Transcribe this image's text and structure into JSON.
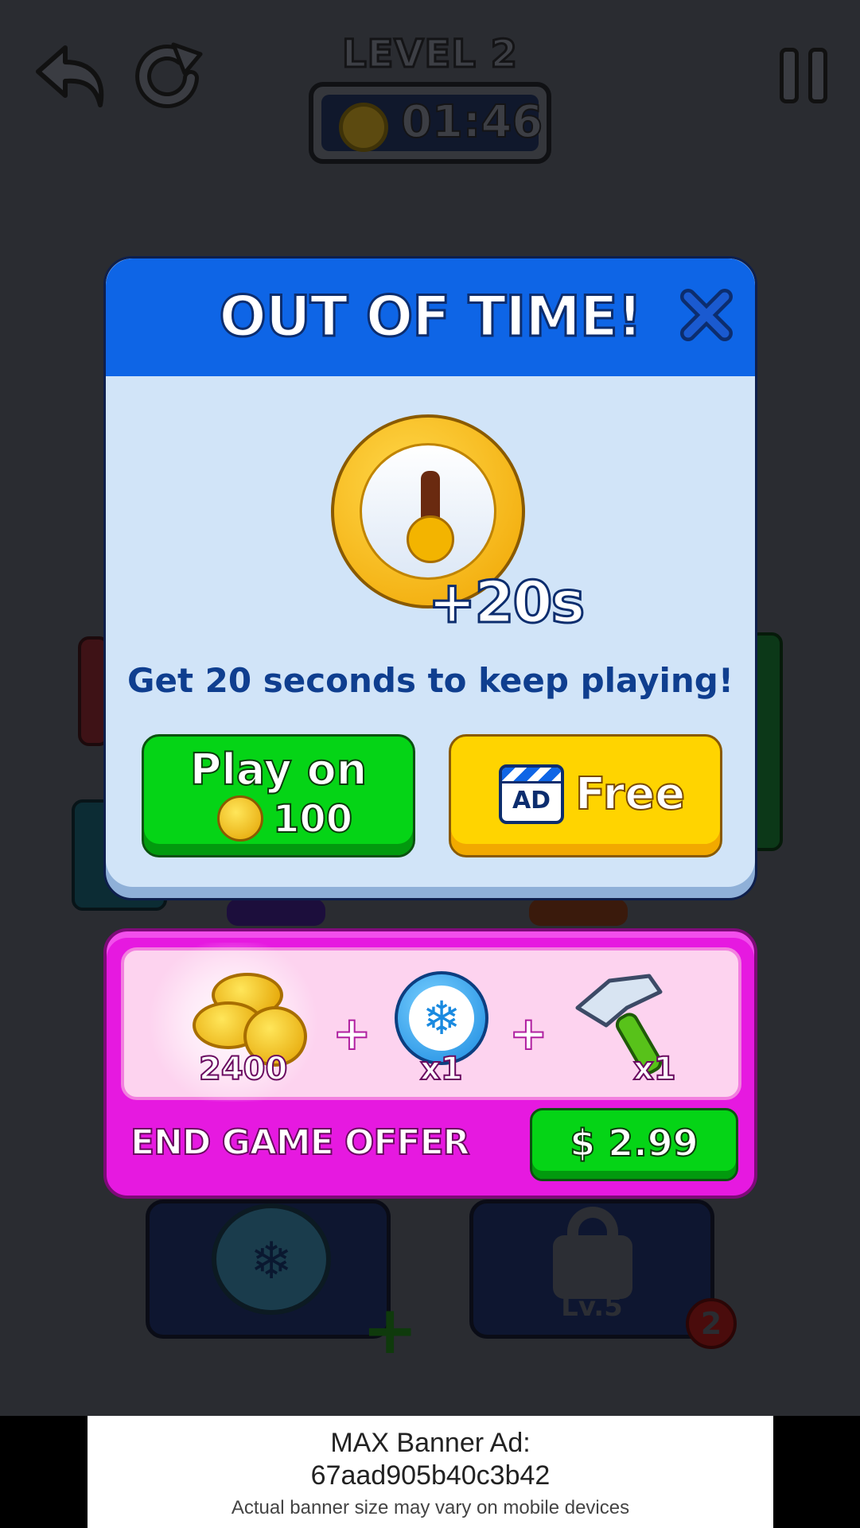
{
  "header": {
    "level": "LEVEL 2",
    "timer": "01:46"
  },
  "board": {
    "lock_level": "Lv.5",
    "lock_badge": "2"
  },
  "modal": {
    "title": "OUT OF TIME!",
    "bonus": "+20s",
    "subtitle": "Get 20 seconds to keep playing!",
    "play_on_label": "Play on",
    "play_on_cost": "100",
    "ad_icon_text": "AD",
    "free_label": "Free"
  },
  "offer": {
    "coins_amount": "2400",
    "freeze_count": "x1",
    "hammer_count": "x1",
    "plus": "+",
    "title": "END GAME OFFER",
    "price": "$ 2.99"
  },
  "banner_ad": {
    "line1": "MAX Banner Ad:",
    "line2": "67aad905b40c3b42",
    "line3": "Actual banner size may vary on mobile devices"
  },
  "colors": {
    "header_blue": "#0e65e6",
    "modal_bg": "#d1e4f8",
    "green": "#05d416",
    "yellow": "#ffd400",
    "offer_pink": "#e619e0"
  },
  "icons": [
    "undo-icon",
    "redo-icon",
    "pause-icon",
    "stopwatch-icon",
    "close-icon",
    "ad-clapper-icon",
    "coin-icon",
    "snowflake-icon",
    "hammer-icon",
    "lock-icon"
  ]
}
